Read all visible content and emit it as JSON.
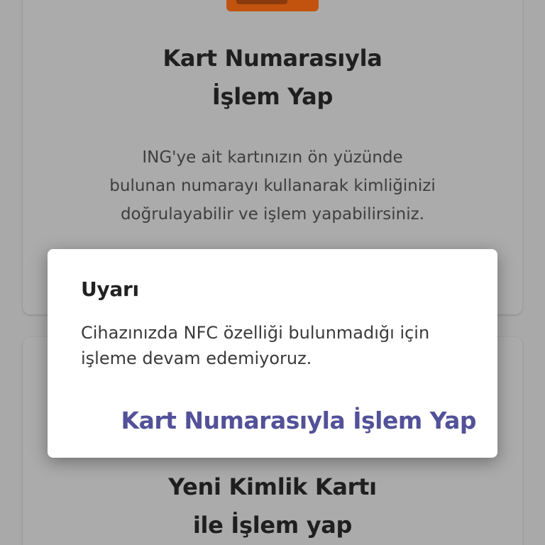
{
  "cards": {
    "card_number": {
      "title_line1": "Kart Numarasıyla",
      "title_line2": "İşlem Yap",
      "description_line1": "ING'ye ait kartınızın ön yüzünde",
      "description_line2": "bulunan numarayı kullanarak kimliğinizi",
      "description_line3": "doğrulayabilir ve işlem yapabilirsiniz."
    },
    "new_id_card": {
      "title_line1": "Yeni Kimlik Kartı",
      "title_line2": "ile İşlem yap"
    }
  },
  "dialog": {
    "title": "Uyarı",
    "message_line1": "Cihazınızda NFC özelliği bulunmadığı için",
    "message_line2": "işleme devam edemiyoruz.",
    "action_label": "Kart Numarasıyla İşlem Yap"
  },
  "colors": {
    "accent": "#525199",
    "card_image": "#c2530f"
  }
}
